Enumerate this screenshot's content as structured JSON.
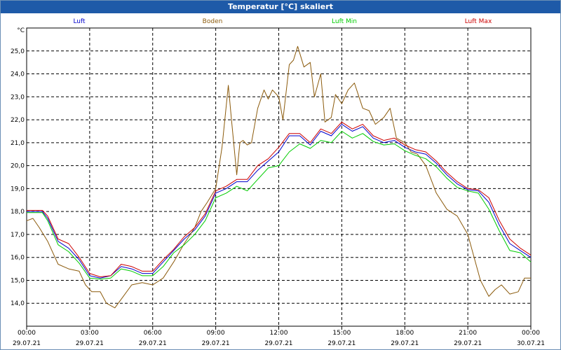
{
  "window": {
    "title": "Temperatur [°C] skaliert"
  },
  "chart_data": {
    "type": "line",
    "title": "Temperatur [°C] skaliert",
    "yunit": "°C",
    "ylim": [
      13.0,
      26.0
    ],
    "yticks": [
      "14,0",
      "15,0",
      "16,0",
      "17,0",
      "18,0",
      "19,0",
      "20,0",
      "21,0",
      "22,0",
      "23,0",
      "24,0",
      "25,0"
    ],
    "xlim": [
      0,
      24
    ],
    "xticks": [
      {
        "time": "00:00",
        "date": "29.07.21"
      },
      {
        "time": "03:00",
        "date": "29.07.21"
      },
      {
        "time": "06:00",
        "date": "29.07.21"
      },
      {
        "time": "09:00",
        "date": "29.07.21"
      },
      {
        "time": "12:00",
        "date": "29.07.21"
      },
      {
        "time": "15:00",
        "date": "29.07.21"
      },
      {
        "time": "18:00",
        "date": "29.07.21"
      },
      {
        "time": "21:00",
        "date": "29.07.21"
      },
      {
        "time": "00:00",
        "date": "30.07.21"
      }
    ],
    "grid": true,
    "legend_position": "top",
    "series": [
      {
        "name": "Luft",
        "color": "#0000cc",
        "x": [
          0,
          0.5,
          0.75,
          1,
          1.5,
          2,
          2.5,
          3,
          3.5,
          4,
          4.5,
          5,
          5.5,
          6,
          6.5,
          7,
          7.5,
          8,
          8.5,
          9,
          9.5,
          10,
          10.5,
          11,
          11.5,
          12,
          12.5,
          13,
          13.5,
          14,
          14.5,
          15,
          15.5,
          16,
          16.5,
          17,
          17.5,
          18,
          18.5,
          19,
          19.5,
          20,
          20.5,
          21,
          21.5,
          22,
          22.5,
          23,
          23.5,
          24
        ],
        "y": [
          18.0,
          18.0,
          18.0,
          17.7,
          16.7,
          16.4,
          15.9,
          15.2,
          15.1,
          15.2,
          15.6,
          15.5,
          15.3,
          15.3,
          15.8,
          16.3,
          16.8,
          17.2,
          17.8,
          18.8,
          19.0,
          19.3,
          19.3,
          19.8,
          20.2,
          20.6,
          21.3,
          21.3,
          20.9,
          21.5,
          21.3,
          21.8,
          21.5,
          21.7,
          21.2,
          21.0,
          21.1,
          20.8,
          20.6,
          20.5,
          20.1,
          19.6,
          19.2,
          18.95,
          18.9,
          18.4,
          17.4,
          16.6,
          16.3,
          16.0
        ]
      },
      {
        "name": "Boden",
        "color": "#8b5a0b",
        "x": [
          0,
          0.3,
          0.6,
          1,
          1.5,
          2,
          2.5,
          2.8,
          3.1,
          3.5,
          3.8,
          4.2,
          4.6,
          5,
          5.5,
          6,
          6.5,
          7,
          7.5,
          8,
          8.3,
          8.6,
          9,
          9.3,
          9.6,
          9.75,
          10,
          10.15,
          10.3,
          10.5,
          10.7,
          11,
          11.3,
          11.5,
          11.7,
          12,
          12.2,
          12.5,
          12.7,
          12.9,
          13.2,
          13.5,
          13.7,
          14,
          14.2,
          14.5,
          14.7,
          15,
          15.3,
          15.6,
          16,
          16.3,
          16.6,
          17,
          17.3,
          17.6,
          18,
          18.3,
          18.6,
          19,
          19.5,
          20,
          20.5,
          21,
          21.3,
          21.6,
          22,
          22.3,
          22.6,
          23,
          23.4,
          23.7,
          24
        ],
        "y": [
          17.6,
          17.7,
          17.3,
          16.7,
          15.7,
          15.5,
          15.4,
          14.8,
          14.5,
          14.5,
          14.0,
          13.8,
          14.3,
          14.8,
          14.9,
          14.8,
          15.1,
          15.8,
          16.6,
          17.3,
          18.0,
          18.4,
          19.0,
          20.8,
          23.5,
          22.0,
          19.6,
          21.0,
          21.1,
          20.9,
          21.0,
          22.5,
          23.3,
          22.9,
          23.3,
          23.0,
          22.0,
          24.4,
          24.6,
          25.2,
          24.3,
          24.5,
          23.0,
          24.0,
          21.9,
          22.1,
          23.1,
          22.7,
          23.3,
          23.6,
          22.5,
          22.4,
          21.8,
          22.1,
          22.5,
          21.2,
          21.0,
          20.6,
          20.5,
          20.0,
          18.8,
          18.1,
          17.8,
          17.0,
          16.0,
          15.0,
          14.3,
          14.6,
          14.8,
          14.4,
          14.5,
          15.1,
          15.1
        ]
      },
      {
        "name": "Luft Min",
        "color": "#00cc00",
        "x": [
          0,
          0.5,
          0.75,
          1,
          1.5,
          2,
          2.5,
          3,
          3.5,
          4,
          4.5,
          5,
          5.5,
          6,
          6.5,
          7,
          7.5,
          8,
          8.5,
          9,
          9.5,
          10,
          10.5,
          11,
          11.5,
          12,
          12.5,
          13,
          13.5,
          14,
          14.5,
          15,
          15.5,
          16,
          16.5,
          17,
          17.5,
          18,
          18.5,
          19,
          19.5,
          20,
          20.5,
          21,
          21.5,
          22,
          22.5,
          23,
          23.5,
          24
        ],
        "y": [
          17.95,
          17.95,
          17.95,
          17.6,
          16.55,
          16.25,
          15.75,
          15.1,
          15.05,
          15.1,
          15.5,
          15.4,
          15.2,
          15.2,
          15.6,
          16.2,
          16.55,
          17.0,
          17.6,
          18.6,
          18.8,
          19.1,
          18.9,
          19.4,
          19.9,
          20.0,
          20.6,
          20.95,
          20.75,
          21.1,
          21.0,
          21.5,
          21.2,
          21.4,
          21.05,
          20.9,
          20.95,
          20.65,
          20.45,
          20.3,
          19.95,
          19.45,
          19.05,
          18.9,
          18.8,
          18.1,
          17.15,
          16.3,
          16.2,
          15.8
        ]
      },
      {
        "name": "Luft Max",
        "color": "#cc0000",
        "x": [
          0,
          0.5,
          0.75,
          1,
          1.5,
          2,
          2.5,
          3,
          3.5,
          4,
          4.5,
          5,
          5.5,
          6,
          6.5,
          7,
          7.5,
          8,
          8.5,
          9,
          9.5,
          10,
          10.5,
          11,
          11.5,
          12,
          12.5,
          13,
          13.5,
          14,
          14.5,
          15,
          15.5,
          16,
          16.5,
          17,
          17.5,
          18,
          18.5,
          19,
          19.5,
          20,
          20.5,
          21,
          21.5,
          22,
          22.5,
          23,
          23.5,
          24
        ],
        "y": [
          18.05,
          18.05,
          18.05,
          17.8,
          16.8,
          16.6,
          16.0,
          15.3,
          15.15,
          15.2,
          15.7,
          15.6,
          15.4,
          15.4,
          15.9,
          16.35,
          16.9,
          17.3,
          17.9,
          18.9,
          19.1,
          19.4,
          19.4,
          20.0,
          20.3,
          20.8,
          21.4,
          21.4,
          21.0,
          21.6,
          21.4,
          21.9,
          21.6,
          21.8,
          21.3,
          21.1,
          21.2,
          20.9,
          20.7,
          20.6,
          20.2,
          19.7,
          19.3,
          19.0,
          18.95,
          18.6,
          17.6,
          16.8,
          16.4,
          16.1
        ]
      }
    ]
  }
}
